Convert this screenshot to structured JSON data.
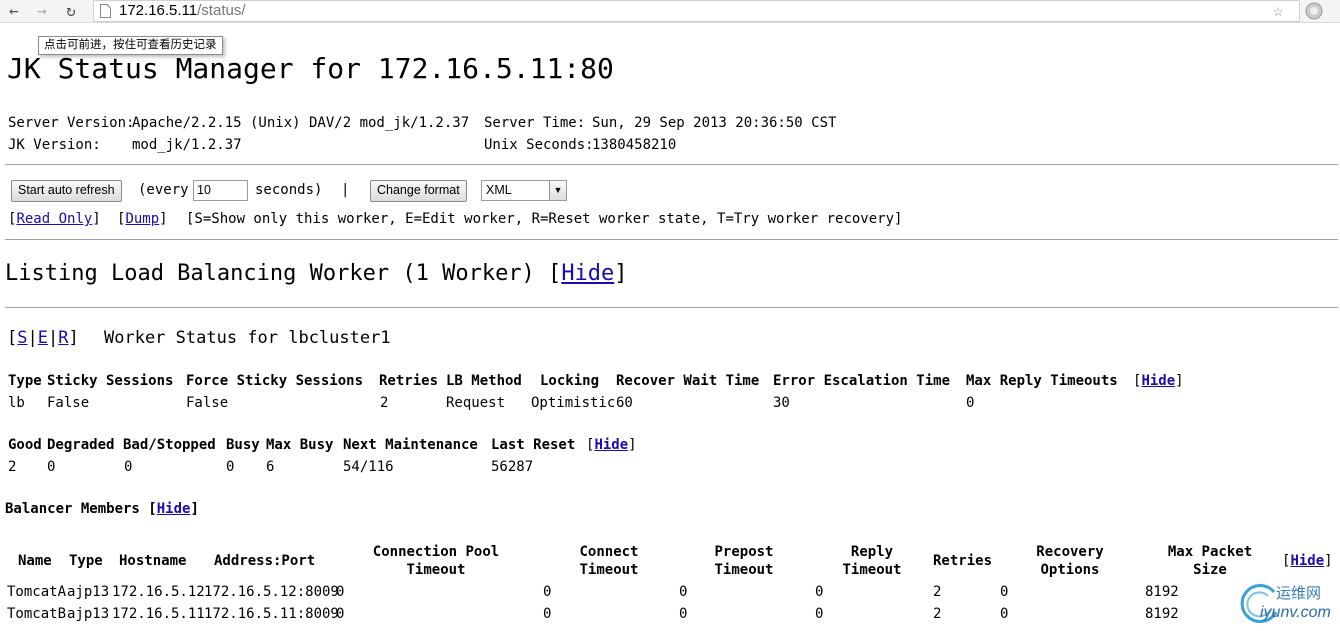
{
  "browser": {
    "url_host": "172.16.5.11",
    "url_path": "/status/",
    "tooltip": "点击可前进，按住可查看历史记录"
  },
  "page": {
    "title": "JK Status Manager for 172.16.5.11:80",
    "server_version_label": "Server Version:",
    "server_version": "Apache/2.2.15 (Unix) DAV/2 mod_jk/1.2.37",
    "jk_version_label": "JK Version:",
    "jk_version": "mod_jk/1.2.37",
    "server_time_label": "Server Time:",
    "server_time": "Sun, 29 Sep 2013 20:36:50 CST",
    "unix_seconds_label": "Unix Seconds:",
    "unix_seconds": "1380458210"
  },
  "controls": {
    "start_refresh": "Start auto refresh",
    "every_label": "(every",
    "refresh_value": "10",
    "seconds_label": "seconds)",
    "separator": "|",
    "change_format": "Change format",
    "format_value": "XML",
    "read_only": "Read Only",
    "dump": "Dump",
    "legend": "[S=Show only this worker, E=Edit worker, R=Reset worker state, T=Try worker recovery]"
  },
  "listing": {
    "heading": "Listing Load Balancing Worker (1 Worker)",
    "hide": "Hide"
  },
  "worker": {
    "s": "S",
    "e": "E",
    "r": "R",
    "title": "Worker Status for lbcluster1",
    "hide": "Hide",
    "lb_headers": [
      "Type",
      "Sticky Sessions",
      "Force Sticky Sessions",
      "Retries",
      "LB Method",
      "Locking",
      "Recover Wait Time",
      "Error Escalation Time",
      "Max Reply Timeouts"
    ],
    "lb_values": [
      "lb",
      "False",
      "False",
      "2",
      "Request",
      "Optimistic",
      "60",
      "30",
      "0"
    ],
    "state_headers": [
      "Good",
      "Degraded",
      "Bad/Stopped",
      "Busy",
      "Max Busy",
      "Next Maintenance",
      "Last Reset"
    ],
    "state_values": [
      "2",
      "0",
      "0",
      "0",
      "6",
      "54/116",
      "56287"
    ]
  },
  "members": {
    "title": "Balancer Members",
    "hide": "Hide",
    "headers": [
      "Name",
      "Type",
      "Hostname",
      "Address:Port",
      "Connection Pool Timeout",
      "Connect Timeout",
      "Prepost Timeout",
      "Reply Timeout",
      "Retries",
      "Recovery Options",
      "Max Packet Size"
    ],
    "rows": [
      [
        "TomcatA",
        "ajp13",
        "172.16.5.12",
        "172.16.5.12:8009",
        "0",
        "0",
        "0",
        "0",
        "2",
        "0",
        "8192"
      ],
      [
        "TomcatB",
        "ajp13",
        "172.16.5.11",
        "172.16.5.11:8009",
        "0",
        "0",
        "0",
        "0",
        "2",
        "0",
        "8192"
      ]
    ]
  },
  "watermark": {
    "brand": "运维网",
    "site": "iyunv.com"
  }
}
